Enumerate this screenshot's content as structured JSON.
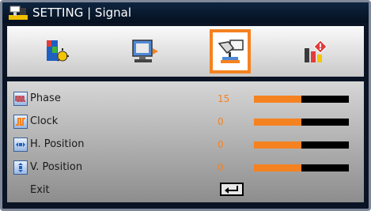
{
  "title": {
    "text": "SETTING | Signal",
    "icon": "monitor-settings-icon"
  },
  "tabs": [
    {
      "name": "picture-tab",
      "icon": "picture-icon",
      "active": false
    },
    {
      "name": "display-tab",
      "icon": "display-icon",
      "active": false
    },
    {
      "name": "setting-tab",
      "icon": "setting-hand-icon",
      "active": true
    },
    {
      "name": "options-tab",
      "icon": "options-icon",
      "active": false
    }
  ],
  "menu": {
    "items": [
      {
        "label": "Phase",
        "value": "15",
        "icon": "phase-waveform-icon",
        "level": 0.5
      },
      {
        "label": "Clock",
        "value": "0",
        "icon": "clock-signal-icon",
        "level": 0.5
      },
      {
        "label": "H. Position",
        "value": "0",
        "icon": "horizontal-position-icon",
        "level": 0.5
      },
      {
        "label": "V. Position",
        "value": "0",
        "icon": "vertical-position-icon",
        "level": 0.5
      }
    ],
    "exit": {
      "label": "Exit",
      "icon": "enter-key-icon"
    }
  },
  "colors": {
    "accent": "#f58220",
    "background": "#0b1425",
    "slider_track": "#000000"
  }
}
